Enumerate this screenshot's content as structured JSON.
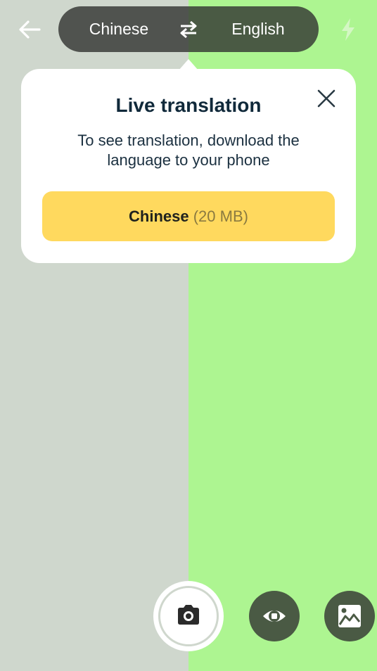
{
  "colors": {
    "bg_left": "#cfd7cd",
    "bg_right": "#adf591",
    "pill_dark": "#4a5a44",
    "download_button": "#ffd95e",
    "title_text": "#10293a"
  },
  "header": {
    "back_icon": "arrow-left-icon",
    "source_language": "Chinese",
    "swap_icon": "swap-arrows-icon",
    "target_language": "English",
    "flash_icon": "flash-icon"
  },
  "popup": {
    "title": "Live translation",
    "description": "To see translation, download the language to your phone",
    "close_icon": "close-icon",
    "download_button": {
      "language": "Chinese",
      "size": "(20 MB)"
    }
  },
  "bottom_controls": {
    "shutter_icon": "camera-icon",
    "live_icon": "eye-icon",
    "gallery_icon": "image-icon"
  }
}
